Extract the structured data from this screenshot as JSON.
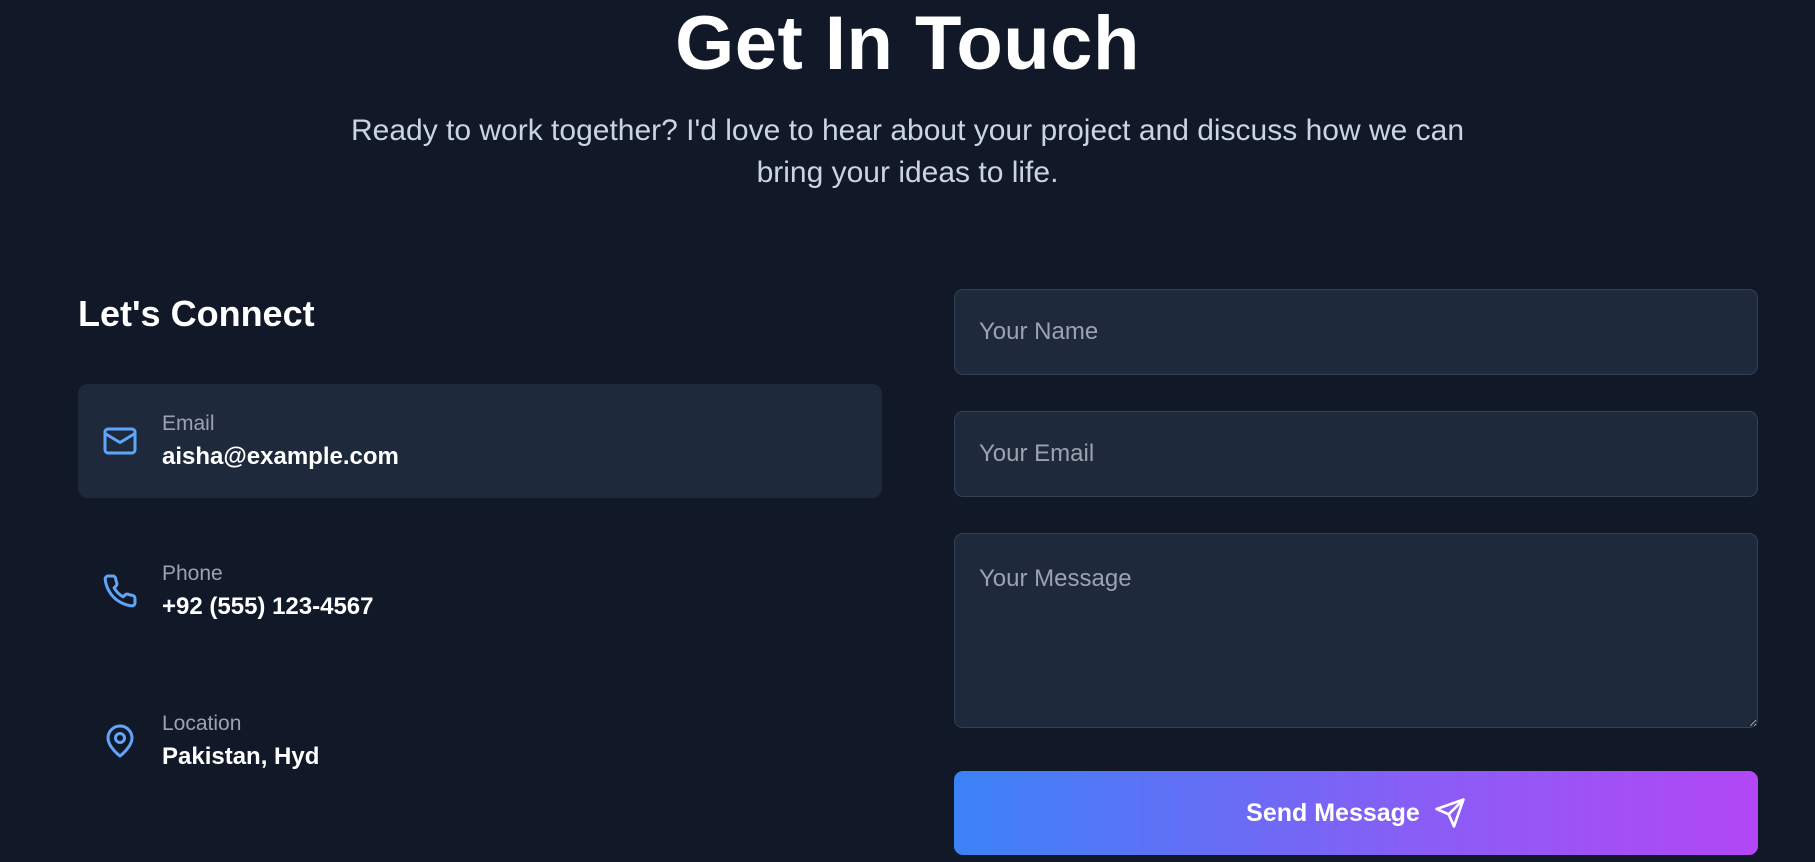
{
  "header": {
    "title": "Get In Touch",
    "subtitle": "Ready to work together? I'd love to hear about your project and discuss how we can bring your ideas to life."
  },
  "contact": {
    "heading": "Let's Connect",
    "items": [
      {
        "label": "Email",
        "value": "aisha@example.com",
        "icon": "mail-icon"
      },
      {
        "label": "Phone",
        "value": "+92 (555) 123-4567",
        "icon": "phone-icon"
      },
      {
        "label": "Location",
        "value": "Pakistan, Hyd",
        "icon": "map-pin-icon"
      }
    ]
  },
  "form": {
    "name_placeholder": "Your Name",
    "name_value": "",
    "email_placeholder": "Your Email",
    "email_value": "",
    "message_placeholder": "Your Message",
    "message_value": "",
    "submit_label": "Send Message",
    "submit_icon": "send-icon"
  },
  "colors": {
    "background": "#111827",
    "card": "#1e293b",
    "accent": "#3b82f6",
    "gradient_start": "#3b82f6",
    "gradient_end": "#b347f5"
  }
}
